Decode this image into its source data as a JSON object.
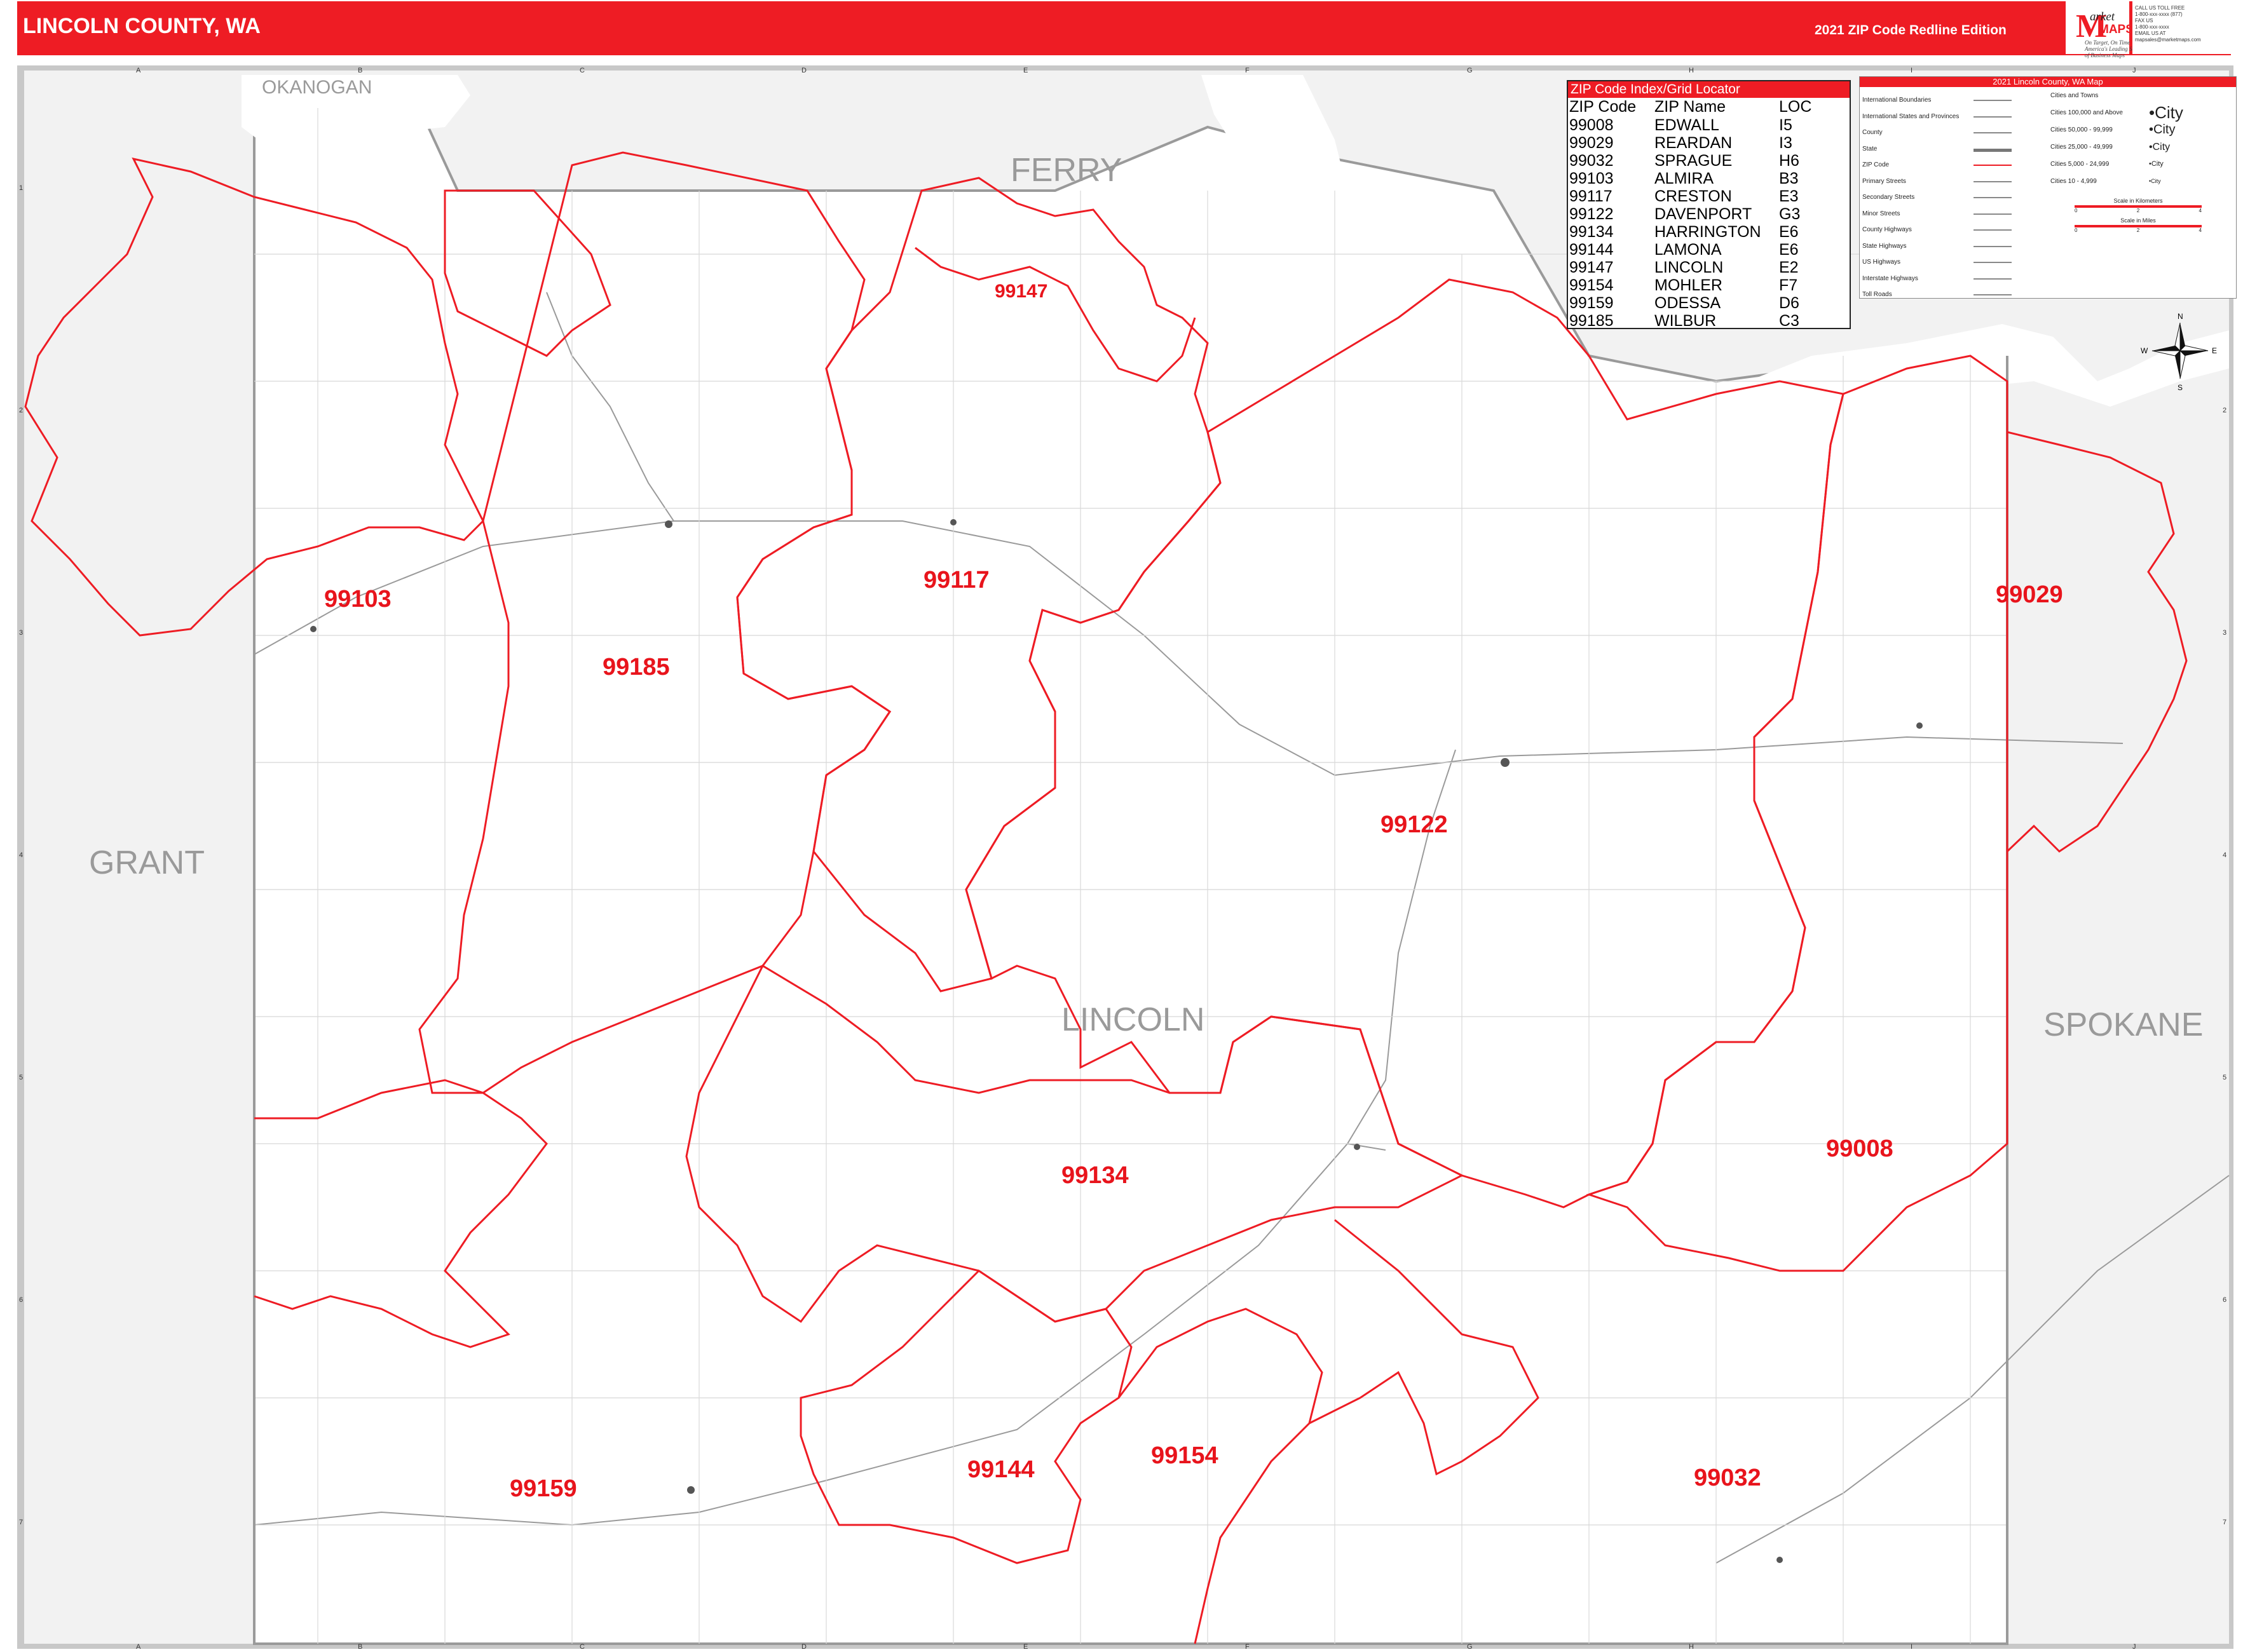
{
  "header": {
    "title": "LINCOLN COUNTY, WA",
    "edition": "2021 ZIP Code Redline Edition"
  },
  "logo": {
    "mark": "M",
    "line1": "arket",
    "line2": "MAPS",
    "tagline1": "On Target, On Time",
    "tagline2": "America's Leading Source of Business Maps"
  },
  "contact": {
    "line1": "CALL US TOLL FREE",
    "line2": "1-800-xxx-xxxx (877)",
    "line3": "FAX US",
    "line4": "1-800-xxx-xxxx",
    "line5": "EMAIL US AT",
    "line6": "mapsales@marketmaps.com"
  },
  "map": {
    "county_name": "LINCOLN",
    "neighbor_counties": [
      {
        "name": "OKANOGAN",
        "size": "small"
      },
      {
        "name": "FERRY",
        "size": "large"
      },
      {
        "name": "GRANT",
        "size": "large"
      },
      {
        "name": "SPOKANE",
        "size": "large"
      }
    ],
    "zip_labels": [
      {
        "zip": "99103"
      },
      {
        "zip": "99185"
      },
      {
        "zip": "99117"
      },
      {
        "zip": "99147"
      },
      {
        "zip": "99122"
      },
      {
        "zip": "99029"
      },
      {
        "zip": "99134"
      },
      {
        "zip": "99008"
      },
      {
        "zip": "99159"
      },
      {
        "zip": "99144"
      },
      {
        "zip": "99154"
      },
      {
        "zip": "99032"
      }
    ],
    "colors": {
      "zip_boundary": "#ee1c24",
      "zip_label": "#e8141c",
      "outside_county": "#f2f2f2",
      "county_boundary": "#9a9a9a",
      "water": "#ffffff",
      "header": "#ee1c24"
    },
    "grid_columns": [
      "A",
      "B",
      "C",
      "D",
      "E",
      "F",
      "G",
      "H",
      "I",
      "J"
    ],
    "grid_rows": [
      "1",
      "2",
      "3",
      "4",
      "5",
      "6",
      "7"
    ]
  },
  "zip_index": {
    "title": "ZIP Code Index/Grid Locator",
    "headers": [
      "ZIP Code",
      "ZIP Name",
      "LOC"
    ],
    "rows": [
      [
        "99008",
        "EDWALL",
        "I5"
      ],
      [
        "99029",
        "REARDAN",
        "I3"
      ],
      [
        "99032",
        "SPRAGUE",
        "H6"
      ],
      [
        "99103",
        "ALMIRA",
        "B3"
      ],
      [
        "99117",
        "CRESTON",
        "E3"
      ],
      [
        "99122",
        "DAVENPORT",
        "G3"
      ],
      [
        "99134",
        "HARRINGTON",
        "E6"
      ],
      [
        "99144",
        "LAMONA",
        "E6"
      ],
      [
        "99147",
        "LINCOLN",
        "E2"
      ],
      [
        "99154",
        "MOHLER",
        "F7"
      ],
      [
        "99159",
        "ODESSA",
        "D6"
      ],
      [
        "99185",
        "WILBUR",
        "C3"
      ]
    ]
  },
  "legend": {
    "title": "2021 Lincoln County, WA Map",
    "line_items": [
      "International Boundaries",
      "International States and Provinces",
      "County",
      "State",
      "ZIP Code",
      "Primary Streets",
      "Secondary Streets",
      "Minor Streets",
      "County Highways",
      "State Highways",
      "US Highways",
      "Interstate Highways",
      "Toll Roads"
    ],
    "cities_heading": "Cities and Towns",
    "city_items": [
      {
        "label": "Cities 100,000 and Above",
        "sample": "•City"
      },
      {
        "label": "Cities 50,000 - 99,999",
        "sample": "•City"
      },
      {
        "label": "Cities 25,000 - 49,999",
        "sample": "•City"
      },
      {
        "label": "Cities 5,000 - 24,999",
        "sample": "•City"
      },
      {
        "label": "Cities 10 - 4,999",
        "sample": "•City"
      }
    ],
    "scale_km": "Scale in Kilometers",
    "scale_km_ticks": [
      "0",
      "2",
      "4"
    ],
    "scale_mi": "Scale in Miles",
    "scale_mi_ticks": [
      "0",
      "2",
      "4"
    ]
  },
  "compass": {
    "n": "N",
    "s": "S",
    "e": "E",
    "w": "W"
  }
}
